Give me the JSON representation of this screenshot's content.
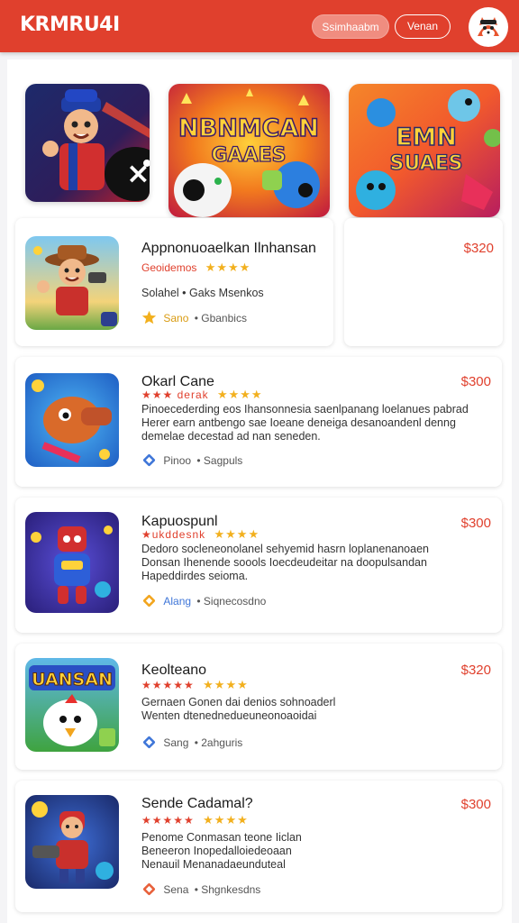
{
  "header": {
    "logo": "KRMRU4I",
    "button_primary": "Ssimhaabm",
    "button_secondary": "Venan",
    "colors": {
      "bar": "#e0402d",
      "price": "#e0402d",
      "star": "#f2b01e"
    }
  },
  "hero": [
    {
      "icon": "hero-character-icon",
      "text": ""
    },
    {
      "icon": "gamepad-icon",
      "line1": "NBNMCAN",
      "line2": "GAAES"
    },
    {
      "icon": "creatures-icon",
      "line1": "EMN",
      "line2": "SUAES"
    }
  ],
  "side_card": {
    "price": "$320"
  },
  "listings": [
    {
      "title": "Appnonuoaelkan Ilnhansan",
      "subtitle": "Geoidemos",
      "red_stars": "",
      "stars": "★★★★",
      "description": "Solahel • Gaks Msenkos",
      "meta_icon": "star-icon",
      "meta_tag": "Sano",
      "meta_text": "• Gbanbics",
      "price": "$320"
    },
    {
      "title": "Okarl Cane",
      "subtitle": "",
      "red_stars": "★★★ derak",
      "stars": "★★★★",
      "description": "Pinoecederding eos Ihansonnesia saenlpanang loelanues pabrad\nHerer earn antbengo sae Ioeane deneiga desanoandenl denng\ndemelae decestad ad nan seneden.",
      "meta_icon": "diamond-icon",
      "meta_tag": "Pinoo",
      "meta_text": "• Sagpuls",
      "price": "$300"
    },
    {
      "title": "Kapuospunl",
      "subtitle": "",
      "red_stars": "★ukddesnk",
      "stars": "★★★★",
      "description": "Dedoro socleneonolanel sehyemid hasrn loplanenanoaen\nDonsan Ihenende soools Ioecdeudeitar na doopulsandan\nHapeddirdes seioma.",
      "meta_icon": "diamond-icon",
      "meta_tag": "Alang",
      "meta_text": "• Siqnecosdno",
      "price": "$300"
    },
    {
      "title": "Keolteano",
      "subtitle": "",
      "red_stars": "★★★★★",
      "stars": "★★★★",
      "description": "Gernaen Gonen dai denios sohnoaderl\nWenten dtenednedueuneonoaoidai",
      "meta_icon": "diamond-icon",
      "meta_tag": "Sang",
      "meta_text": "• 2ahguris",
      "price": "$320"
    },
    {
      "title": "Sende Cadamal?",
      "subtitle": "",
      "red_stars": "★★★★★",
      "stars": "★★★★",
      "description": "Penome Conmasan teone Iiclan\nBeneeron Inopedalloiedeoaan\nNenauil Menanadaeunduteal",
      "meta_icon": "diamond-icon",
      "meta_tag": "Sena",
      "meta_text": "• Shgnkesdns",
      "price": "$300"
    }
  ]
}
